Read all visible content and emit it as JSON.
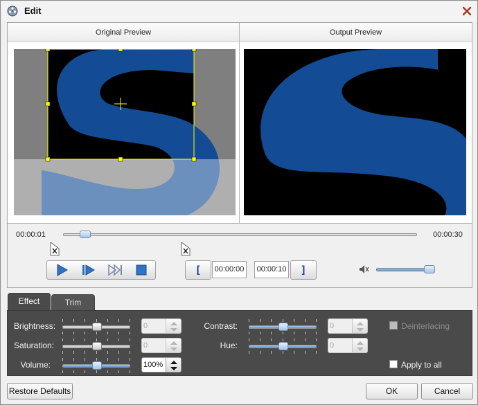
{
  "window": {
    "title": "Edit",
    "icons": {
      "app": "film-reel-icon",
      "close": "close-icon"
    }
  },
  "preview": {
    "original_label": "Original Preview",
    "output_label": "Output Preview"
  },
  "timeline": {
    "start_time": "00:00:01",
    "end_time": "00:00:30"
  },
  "playback": {
    "icons": [
      "play-icon",
      "next-frame-icon",
      "step-forward-icon",
      "stop-icon"
    ]
  },
  "trim": {
    "start_bracket": "[",
    "end_bracket": "]",
    "start_value": "00:00:00",
    "end_value": "00:00:10"
  },
  "audio": {
    "icon": "speaker-muted-icon"
  },
  "tabs": [
    {
      "label": "Effect",
      "active": true
    },
    {
      "label": "Trim",
      "active": false
    }
  ],
  "effect": {
    "brightness": {
      "label": "Brightness:",
      "value": "0"
    },
    "saturation": {
      "label": "Saturation:",
      "value": "0"
    },
    "volume": {
      "label": "Volume:",
      "value": "100%"
    },
    "contrast": {
      "label": "Contrast:",
      "value": "0"
    },
    "hue": {
      "label": "Hue:",
      "value": "0"
    },
    "deinterlacing": {
      "label": "Deinterlacing",
      "checked": false,
      "disabled": true
    },
    "apply_to_all": {
      "label": "Apply to all",
      "checked": false
    }
  },
  "buttons": {
    "restore": "Restore Defaults",
    "ok": "OK",
    "cancel": "Cancel"
  },
  "colors": {
    "accent_blue": "#134c95",
    "crop_frame": "#ffff00",
    "panel_bg": "#4a4a4a"
  }
}
